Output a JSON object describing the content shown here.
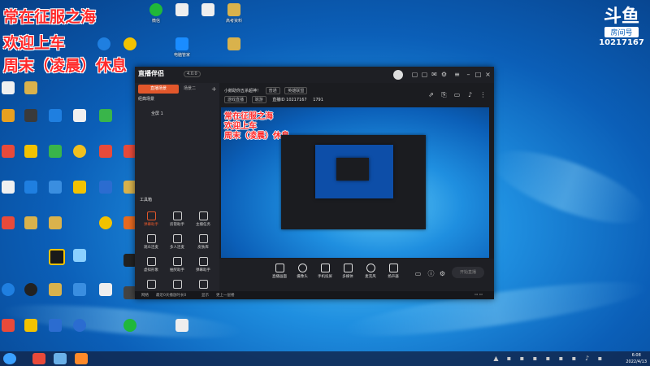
{
  "overlay": {
    "line1": "常在征服之海",
    "line2": "欢迎上车",
    "line3": "周末（凌晨）休息"
  },
  "watermark": {
    "mark": "斗鱼",
    "sub": "房间号",
    "room_id": "10217167"
  },
  "desktop": {
    "icons": [
      {
        "label": "微信",
        "color": "#20b83a"
      },
      {
        "label": "360",
        "color": "#f2c200"
      },
      {
        "label": "文件",
        "color": "#e8e8e8"
      },
      {
        "label": "编程",
        "color": "#e8e8e8"
      },
      {
        "label": "高考资料",
        "color": "#d9b24c"
      },
      {
        "label": "应用",
        "color": "#1f7fe0"
      },
      {
        "label": "电脑管家",
        "color": "#1a8cff"
      },
      {
        "label": "文件夹",
        "color": "#d9b24c"
      }
    ]
  },
  "app": {
    "brand": "直播伴侣",
    "badge": "4.0.0",
    "tabs": {
      "scene": "直播场景",
      "other": "场景二"
    },
    "scenes": [
      "经典场景",
      "全屏 1"
    ],
    "toolbox_title": "工具箱",
    "tools": [
      "弹幕助手",
      "房管助手",
      "主播任务",
      "观众连麦",
      "多人连麦",
      "皮肤库",
      "虚拟形象",
      "抽奖助手",
      "弹幕助手",
      "开播提醒",
      "礼物特效",
      "更多工具"
    ],
    "room": {
      "title": "小鹅助你五杀超神！",
      "status": "普通",
      "category": "英雄联盟",
      "mode": "游戏直播",
      "tag": "端游",
      "stats": "直播ID 10217167",
      "likes": "1791"
    },
    "preview_text": [
      "常在征服之海",
      "欢迎上车",
      "周末（凌晨）休息"
    ],
    "bottom_buttons": [
      "直播画面",
      "摄像头",
      "手机投屏",
      "多媒体",
      "麦克风",
      "扬声器"
    ],
    "live_button": "开始直播",
    "status_items": [
      "网络",
      "最近0天播放时长0",
      "显示",
      "更上一层楼"
    ]
  },
  "taskbar": {
    "time": "6:08",
    "date": "2022/4/13",
    "apps": [
      {
        "name": "start",
        "color": "#3aa0ff"
      },
      {
        "name": "wps",
        "color": "#e84a3a"
      },
      {
        "name": "cloud",
        "color": "#6ab0e8"
      },
      {
        "name": "browser",
        "color": "#ff8a2a"
      }
    ]
  }
}
